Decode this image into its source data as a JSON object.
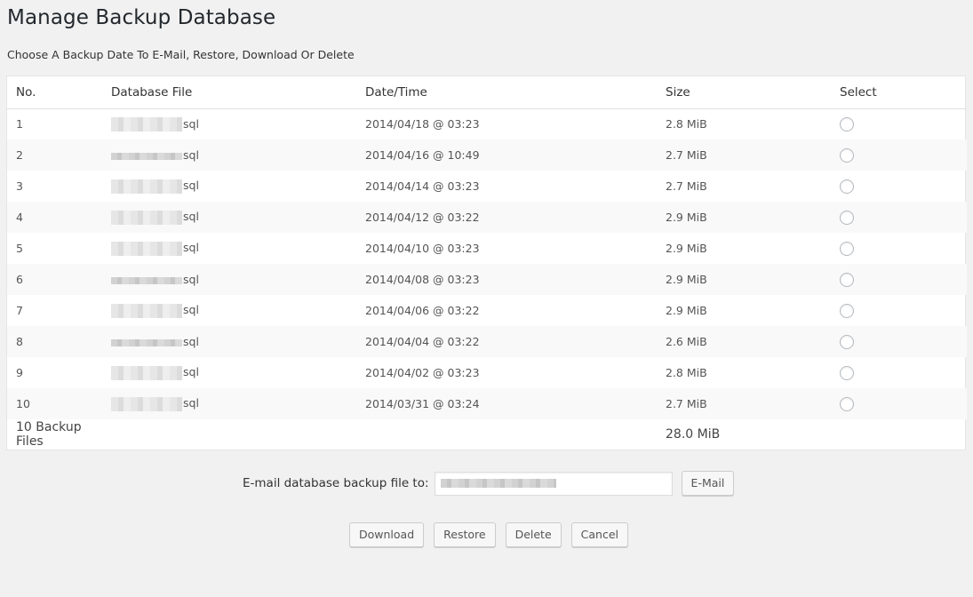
{
  "page": {
    "title": "Manage Backup Database",
    "subtitle": "Choose A Backup Date To E-Mail, Restore, Download Or Delete"
  },
  "table": {
    "headers": {
      "no": "No.",
      "file": "Database File",
      "datetime": "Date/Time",
      "size": "Size",
      "select": "Select"
    },
    "rows": [
      {
        "no": "1",
        "file_ext": "sql",
        "datetime": "2014/04/18 @ 03:23",
        "size": "2.8 MiB"
      },
      {
        "no": "2",
        "file_ext": "sql",
        "datetime": "2014/04/16 @ 10:49",
        "size": "2.7 MiB"
      },
      {
        "no": "3",
        "file_ext": "sql",
        "datetime": "2014/04/14 @ 03:23",
        "size": "2.7 MiB"
      },
      {
        "no": "4",
        "file_ext": "sql",
        "datetime": "2014/04/12 @ 03:22",
        "size": "2.9 MiB"
      },
      {
        "no": "5",
        "file_ext": "sql",
        "datetime": "2014/04/10 @ 03:23",
        "size": "2.9 MiB"
      },
      {
        "no": "6",
        "file_ext": "sql",
        "datetime": "2014/04/08 @ 03:23",
        "size": "2.9 MiB"
      },
      {
        "no": "7",
        "file_ext": "sql",
        "datetime": "2014/04/06 @ 03:22",
        "size": "2.9 MiB"
      },
      {
        "no": "8",
        "file_ext": "sql",
        "datetime": "2014/04/04 @ 03:22",
        "size": "2.6 MiB"
      },
      {
        "no": "9",
        "file_ext": "sql",
        "datetime": "2014/04/02 @ 03:23",
        "size": "2.8 MiB"
      },
      {
        "no": "10",
        "file_ext": "sql",
        "datetime": "2014/03/31 @ 03:24",
        "size": "2.7 MiB"
      }
    ],
    "footer": {
      "count_label": "10 Backup Files",
      "total_size": "28.0 MiB"
    }
  },
  "email": {
    "label": "E-mail database backup file to:",
    "button": "E-Mail"
  },
  "actions": {
    "download": "Download",
    "restore": "Restore",
    "delete": "Delete",
    "cancel": "Cancel"
  }
}
